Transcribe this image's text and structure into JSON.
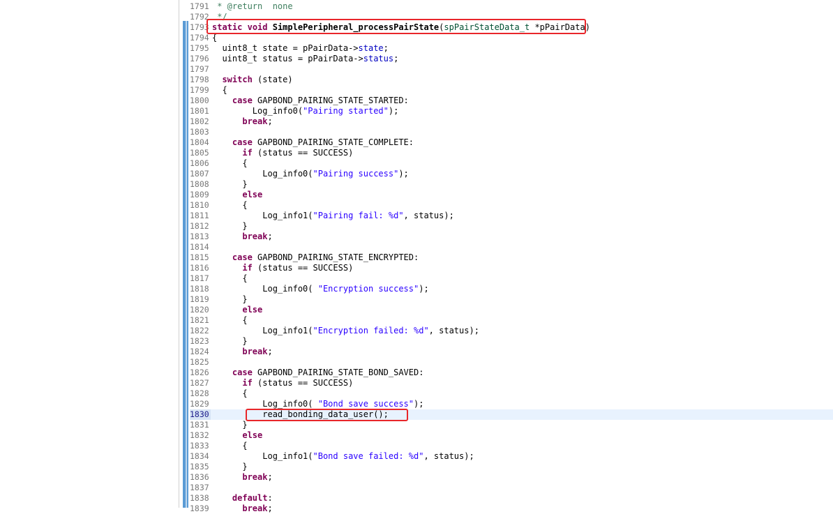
{
  "editor": {
    "lines": [
      {
        "num": "1791",
        "html": "<span class=\"cm\"> * @return  none</span>"
      },
      {
        "num": "1792",
        "html": "<span class=\"cm\"> */</span>"
      },
      {
        "num": "1793",
        "html": "<span class=\"kw\">static</span> <span class=\"kw\">void</span> <span class=\"fn\">SimplePeripheral_processPairState</span>(<span class=\"typ\">spPairStateData_t</span> *pPairData)"
      },
      {
        "num": "1794",
        "html": "{"
      },
      {
        "num": "1795",
        "html": "  uint8_t state = pPairData-><span class=\"fld\">state</span>;"
      },
      {
        "num": "1796",
        "html": "  uint8_t status = pPairData-><span class=\"fld\">status</span>;"
      },
      {
        "num": "1797",
        "html": ""
      },
      {
        "num": "1798",
        "html": "  <span class=\"kw\">switch</span> (state)"
      },
      {
        "num": "1799",
        "html": "  {"
      },
      {
        "num": "1800",
        "html": "    <span class=\"kw\">case</span> GAPBOND_PAIRING_STATE_STARTED:"
      },
      {
        "num": "1801",
        "html": "        Log_info0(<span class=\"str\">\"Pairing started\"</span>);"
      },
      {
        "num": "1802",
        "html": "      <span class=\"kw\">break</span>;"
      },
      {
        "num": "1803",
        "html": ""
      },
      {
        "num": "1804",
        "html": "    <span class=\"kw\">case</span> GAPBOND_PAIRING_STATE_COMPLETE:"
      },
      {
        "num": "1805",
        "html": "      <span class=\"kw\">if</span> (status == SUCCESS)"
      },
      {
        "num": "1806",
        "html": "      {"
      },
      {
        "num": "1807",
        "html": "          Log_info0(<span class=\"str\">\"Pairing success\"</span>);"
      },
      {
        "num": "1808",
        "html": "      }"
      },
      {
        "num": "1809",
        "html": "      <span class=\"kw\">else</span>"
      },
      {
        "num": "1810",
        "html": "      {"
      },
      {
        "num": "1811",
        "html": "          Log_info1(<span class=\"str\">\"Pairing fail: %d\"</span>, status);"
      },
      {
        "num": "1812",
        "html": "      }"
      },
      {
        "num": "1813",
        "html": "      <span class=\"kw\">break</span>;"
      },
      {
        "num": "1814",
        "html": ""
      },
      {
        "num": "1815",
        "html": "    <span class=\"kw\">case</span> GAPBOND_PAIRING_STATE_ENCRYPTED:"
      },
      {
        "num": "1816",
        "html": "      <span class=\"kw\">if</span> (status == SUCCESS)"
      },
      {
        "num": "1817",
        "html": "      {"
      },
      {
        "num": "1818",
        "html": "          Log_info0( <span class=\"str\">\"Encryption success\"</span>);"
      },
      {
        "num": "1819",
        "html": "      }"
      },
      {
        "num": "1820",
        "html": "      <span class=\"kw\">else</span>"
      },
      {
        "num": "1821",
        "html": "      {"
      },
      {
        "num": "1822",
        "html": "          Log_info1(<span class=\"str\">\"Encryption failed: %d\"</span>, status);"
      },
      {
        "num": "1823",
        "html": "      }"
      },
      {
        "num": "1824",
        "html": "      <span class=\"kw\">break</span>;"
      },
      {
        "num": "1825",
        "html": ""
      },
      {
        "num": "1826",
        "html": "    <span class=\"kw\">case</span> GAPBOND_PAIRING_STATE_BOND_SAVED:"
      },
      {
        "num": "1827",
        "html": "      <span class=\"kw\">if</span> (status == SUCCESS)"
      },
      {
        "num": "1828",
        "html": "      {"
      },
      {
        "num": "1829",
        "html": "          Log_info0( <span class=\"str\">\"Bond save success\"</span>);"
      },
      {
        "num": "1830",
        "html": "          read_bonding_data_user();"
      },
      {
        "num": "1831",
        "html": "      }"
      },
      {
        "num": "1832",
        "html": "      <span class=\"kw\">else</span>"
      },
      {
        "num": "1833",
        "html": "      {"
      },
      {
        "num": "1834",
        "html": "          Log_info1(<span class=\"str\">\"Bond save failed: %d\"</span>, status);"
      },
      {
        "num": "1835",
        "html": "      }"
      },
      {
        "num": "1836",
        "html": "      <span class=\"kw\">break</span>;"
      },
      {
        "num": "1837",
        "html": ""
      },
      {
        "num": "1838",
        "html": "    <span class=\"kw\">default</span>:"
      },
      {
        "num": "1839",
        "html": "      <span class=\"kw\">break</span>;"
      }
    ],
    "current_line": "1830",
    "colors": {
      "keyword": "#7f0055",
      "string": "#2a00ff",
      "comment": "#3f7f5f",
      "field": "#0000c0",
      "highlight_box": "#e8262a",
      "current_line_bg": "#e8f2fe",
      "change_ruler": "#5b9bd5"
    }
  }
}
